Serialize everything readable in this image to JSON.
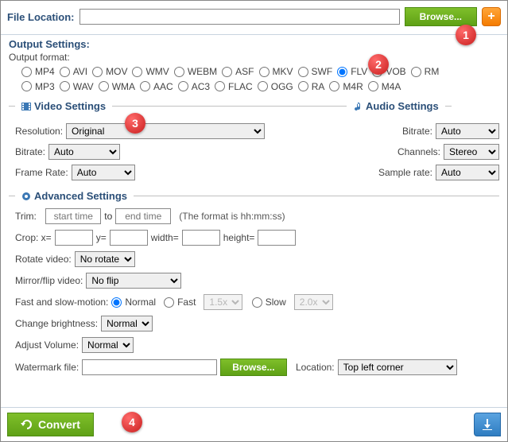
{
  "file": {
    "label": "File Location:",
    "browse": "Browse...",
    "plus": "+"
  },
  "output": {
    "title": "Output Settings:",
    "format_label": "Output format:",
    "formats_row1": [
      "MP4",
      "AVI",
      "MOV",
      "WMV",
      "WEBM",
      "ASF",
      "MKV",
      "SWF",
      "FLV",
      "VOB",
      "RM"
    ],
    "formats_row2": [
      "MP3",
      "WAV",
      "WMA",
      "AAC",
      "AC3",
      "FLAC",
      "OGG",
      "RA",
      "M4R",
      "M4A"
    ],
    "selected": "FLV"
  },
  "video": {
    "title": "Video Settings",
    "resolution_label": "Resolution:",
    "resolution": "Original",
    "bitrate_label": "Bitrate:",
    "bitrate": "Auto",
    "framerate_label": "Frame Rate:",
    "framerate": "Auto"
  },
  "audio": {
    "title": "Audio Settings",
    "bitrate_label": "Bitrate:",
    "bitrate": "Auto",
    "channels_label": "Channels:",
    "channels": "Stereo",
    "samplerate_label": "Sample rate:",
    "samplerate": "Auto"
  },
  "advanced": {
    "title": "Advanced Settings",
    "trim_label": "Trim:",
    "trim_start_ph": "start time",
    "trim_to": "to",
    "trim_end_ph": "end time",
    "trim_note": "(The format is hh:mm:ss)",
    "crop_label": "Crop: x=",
    "crop_y": "y=",
    "crop_w": "width=",
    "crop_h": "height=",
    "rotate_label": "Rotate video:",
    "rotate": "No rotate",
    "mirror_label": "Mirror/flip video:",
    "mirror": "No flip",
    "speed_label": "Fast and slow-motion:",
    "speed_normal": "Normal",
    "speed_fast": "Fast",
    "speed_fast_val": "1.5x",
    "speed_slow": "Slow",
    "speed_slow_val": "2.0x",
    "brightness_label": "Change brightness:",
    "brightness": "Normal",
    "volume_label": "Adjust Volume:",
    "volume": "Normal",
    "wm_label": "Watermark file:",
    "wm_browse": "Browse...",
    "wm_loc_label": "Location:",
    "wm_loc": "Top left corner"
  },
  "footer": {
    "convert": "Convert"
  },
  "badges": {
    "b1": "1",
    "b2": "2",
    "b3": "3",
    "b4": "4"
  }
}
